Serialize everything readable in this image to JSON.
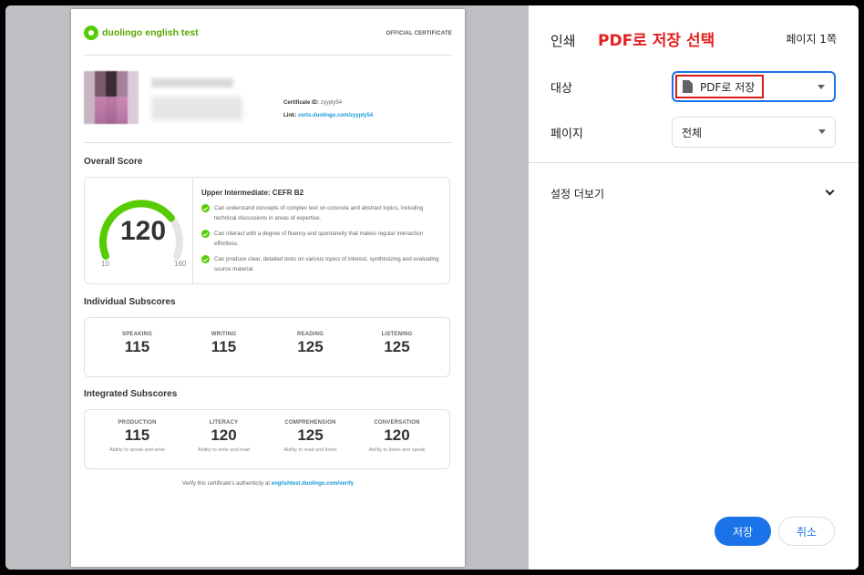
{
  "certificate": {
    "logo_text": "duolingo english test",
    "official_label": "OFFICIAL CERTIFICATE",
    "certificate_id_label": "Certificate ID:",
    "certificate_id_value": "zyyply54",
    "link_label": "Link:",
    "link_value": "certs.duolingo.com/zyyply54",
    "overall_title": "Overall Score",
    "overall_score": "120",
    "gauge_min": "10",
    "gauge_max": "160",
    "gauge_fraction": 0.73,
    "level_title": "Upper Intermediate: CEFR B2",
    "descriptors": [
      "Can understand concepts of complex text on concrete and abstract topics, including technical discussions in areas of expertise.",
      "Can interact with a degree of fluency and spontaneity that makes regular interaction effortless.",
      "Can produce clear, detailed texts on various topics of interest, synthesizing and evaluating source material."
    ],
    "individual_title": "Individual Subscores",
    "individual": [
      {
        "label": "SPEAKING",
        "value": "115"
      },
      {
        "label": "WRITING",
        "value": "115"
      },
      {
        "label": "READING",
        "value": "125"
      },
      {
        "label": "LISTENING",
        "value": "125"
      }
    ],
    "integrated_title": "Integrated Subscores",
    "integrated": [
      {
        "label": "PRODUCTION",
        "value": "115",
        "desc": "Ability to speak and write"
      },
      {
        "label": "LITERACY",
        "value": "120",
        "desc": "Ability to write and read"
      },
      {
        "label": "COMPREHENSION",
        "value": "125",
        "desc": "Ability to read and listen"
      },
      {
        "label": "CONVERSATION",
        "value": "120",
        "desc": "Ability to listen and speak"
      }
    ],
    "verify_text": "Verify this certificate's authenticity at",
    "verify_link": "englishtest.duolingo.com/verify"
  },
  "print_panel": {
    "title": "인쇄",
    "annotation": "PDF로 저장 선택",
    "page_count": "페이지 1쪽",
    "destination_label": "대상",
    "destination_value": "PDF로 저장",
    "pages_label": "페이지",
    "pages_value": "전체",
    "more_settings": "설정 더보기",
    "save_button": "저장",
    "cancel_button": "취소"
  },
  "colors": {
    "accent_blue": "#1a73e8",
    "duolingo_green": "#58cc02",
    "annotation_red": "#e3211f",
    "link_blue": "#1899d6"
  }
}
